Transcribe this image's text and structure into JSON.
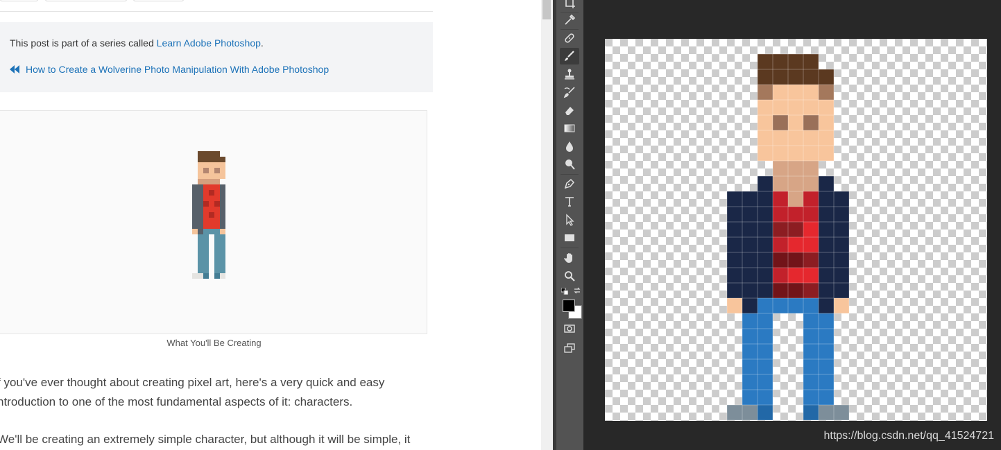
{
  "article": {
    "series_prefix": "This post is part of a series called ",
    "series_link": "Learn Adobe Photoshop",
    "series_suffix": ".",
    "prev_link": "How to Create a Wolverine Photo Manipulation With Adobe Photoshop",
    "caption": "What You'll Be Creating",
    "paragraph_1": "f you've ever thought about creating pixel art, here's a very quick and easy ntroduction to one of the most fundamental aspects of it: characters.",
    "paragraph_2": "We'll be creating an extremely simple character, but although it will be simple, it"
  },
  "photoshop": {
    "tools": [
      {
        "name": "crop-icon"
      },
      {
        "name": "eyedropper-icon"
      },
      {
        "name": "healing-brush-icon"
      },
      {
        "name": "brush-icon",
        "active": true
      },
      {
        "name": "clone-stamp-icon"
      },
      {
        "name": "history-brush-icon"
      },
      {
        "name": "eraser-icon"
      },
      {
        "name": "gradient-icon"
      },
      {
        "name": "blur-icon"
      },
      {
        "name": "dodge-icon"
      },
      {
        "name": "pen-icon"
      },
      {
        "name": "type-icon"
      },
      {
        "name": "path-selection-icon"
      },
      {
        "name": "rectangle-icon"
      },
      {
        "name": "hand-icon"
      },
      {
        "name": "zoom-icon"
      },
      {
        "name": "quick-mask-icon"
      },
      {
        "name": "screen-mode-icon"
      }
    ],
    "colors": {
      "foreground": "#000000",
      "background": "#ffffff"
    },
    "watermark": "https://blog.csdn.net/qq_41524721"
  },
  "sprite": {
    "palette": {
      "H": "#5b3920",
      "h": "#a4785c",
      "S": "#f8c59c",
      "E": "#9a7059",
      "N": "#d7a586",
      "J": "#1a2747",
      "R": "#c2212b",
      "r": "#e5282e",
      "d": "#8c1d22",
      "k": "#721419",
      "P": "#2b7ac2",
      "p": "#2268a7",
      "G": "#7d8e9a"
    },
    "rows": [
      "...HHHH..",
      "...HHHHH.",
      "...hSSSh.",
      "...SSSSS.",
      "...SESES.",
      "...SSSSS.",
      "...SSSSS.",
      "....NNN..",
      "...JNNNJ.",
      ".JJJRNRJJ",
      ".JJJRRRJJ",
      ".JJJddrJJ",
      ".JJJRrrJJ",
      ".JJJkkdJJ",
      ".JJJRrrJJ",
      ".JJJkkdJJ",
      ".SJPPPPJS",
      "..PP..PP.",
      "..PP..PP.",
      "..PP..PP.",
      "..PP..PP.",
      "..PP..PP.",
      "..PP..PP.",
      ".GGp..pGG"
    ]
  },
  "small_sprite": {
    "palette": {
      "H": "#6b4a2d",
      "S": "#f5c49b",
      "E": "#b38670",
      "N": "#d5a07f",
      "J": "#57606a",
      "R": "#e23a2c",
      "d": "#b22a22",
      "P": "#5b93a7",
      "p": "#447d94",
      "G": "#e5e4e1"
    },
    "rows": [
      ".HHHH.",
      ".HHHHH",
      ".SSSSS",
      ".SESES",
      ".SSSSS",
      ".NNNN.",
      "JJRRRJ",
      "JJRdRJ",
      "JJRRRJ",
      "JJdRdJ",
      "JJRRRJ",
      "JJRdRJ",
      "JJRRRJ",
      "JJRRRJ",
      "SJPPPS",
      ".PP.PP",
      ".PP.PP",
      ".PP.PP",
      ".PP.PP",
      ".PP.PP",
      ".PP.PP",
      ".PP.PP",
      "GGp.pG"
    ]
  }
}
